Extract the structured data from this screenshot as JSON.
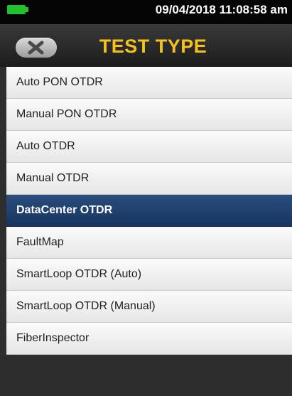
{
  "status_bar": {
    "datetime": "09/04/2018 11:08:58 am",
    "battery_color": "#22c12e"
  },
  "header": {
    "title": "TEST TYPE",
    "back_icon": "close-x-icon",
    "title_color": "#f4c21c"
  },
  "test_types": {
    "items": [
      {
        "label": "Auto PON OTDR",
        "selected": false
      },
      {
        "label": "Manual PON OTDR",
        "selected": false
      },
      {
        "label": "Auto OTDR",
        "selected": false
      },
      {
        "label": "Manual OTDR",
        "selected": false
      },
      {
        "label": "DataCenter OTDR",
        "selected": true
      },
      {
        "label": "FaultMap",
        "selected": false
      },
      {
        "label": "SmartLoop OTDR (Auto)",
        "selected": false
      },
      {
        "label": "SmartLoop OTDR (Manual)",
        "selected": false
      },
      {
        "label": "FiberInspector",
        "selected": false
      }
    ],
    "selected_color": "#1f3f6c"
  }
}
